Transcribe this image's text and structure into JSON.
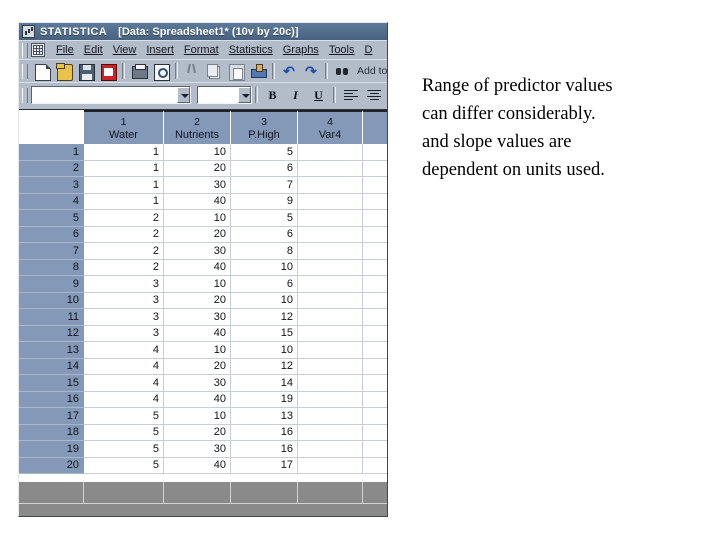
{
  "window": {
    "title_app": "STATISTICA",
    "title_document": "[Data: Spreadsheet1* (10v by 20c)]",
    "title_icon": "statistica-logo-icon"
  },
  "menu": {
    "doc_icon": "spreadsheet-icon",
    "items": [
      {
        "label": "File"
      },
      {
        "label": "Edit"
      },
      {
        "label": "View"
      },
      {
        "label": "Insert"
      },
      {
        "label": "Format"
      },
      {
        "label": "Statistics"
      },
      {
        "label": "Graphs"
      },
      {
        "label": "Tools"
      },
      {
        "label": "D"
      }
    ]
  },
  "toolbar_standard": {
    "buttons": [
      {
        "name": "new-document-icon"
      },
      {
        "name": "open-folder-icon"
      },
      {
        "name": "save-disk-icon"
      },
      {
        "name": "export-pdf-icon"
      },
      {
        "name": "print-icon"
      },
      {
        "name": "print-preview-icon"
      },
      {
        "name": "cut-scissors-icon"
      },
      {
        "name": "copy-icon"
      },
      {
        "name": "paste-icon"
      },
      {
        "name": "format-painter-icon"
      },
      {
        "name": "undo-icon"
      },
      {
        "name": "redo-icon"
      },
      {
        "name": "find-binoculars-icon"
      }
    ],
    "add_to_workbook_label": "Add to Workboo",
    "undo_glyph": "↶",
    "redo_glyph": "↷"
  },
  "toolbar_format": {
    "font_value": "",
    "font_placeholder": "",
    "size_value": "",
    "bold_label": "B",
    "italic_label": "I",
    "underline_label": "U",
    "align_left": "align-left-icon",
    "align_center": "align-center-icon",
    "align_right": "align-right-icon",
    "misc": "cell-properties-icon"
  },
  "spreadsheet": {
    "columns": [
      {
        "index": "1",
        "name": "Water"
      },
      {
        "index": "2",
        "name": "Nutrients"
      },
      {
        "index": "3",
        "name": "P.High"
      },
      {
        "index": "4",
        "name": "Var4"
      },
      {
        "index": "",
        "name": ""
      }
    ],
    "rows": [
      {
        "n": "1",
        "c": [
          "1",
          "10",
          "5",
          "",
          ""
        ]
      },
      {
        "n": "2",
        "c": [
          "1",
          "20",
          "6",
          "",
          ""
        ]
      },
      {
        "n": "3",
        "c": [
          "1",
          "30",
          "7",
          "",
          ""
        ]
      },
      {
        "n": "4",
        "c": [
          "1",
          "40",
          "9",
          "",
          ""
        ]
      },
      {
        "n": "5",
        "c": [
          "2",
          "10",
          "5",
          "",
          ""
        ]
      },
      {
        "n": "6",
        "c": [
          "2",
          "20",
          "6",
          "",
          ""
        ]
      },
      {
        "n": "7",
        "c": [
          "2",
          "30",
          "8",
          "",
          ""
        ]
      },
      {
        "n": "8",
        "c": [
          "2",
          "40",
          "10",
          "",
          ""
        ]
      },
      {
        "n": "9",
        "c": [
          "3",
          "10",
          "6",
          "",
          ""
        ]
      },
      {
        "n": "10",
        "c": [
          "3",
          "20",
          "10",
          "",
          ""
        ]
      },
      {
        "n": "11",
        "c": [
          "3",
          "30",
          "12",
          "",
          ""
        ]
      },
      {
        "n": "12",
        "c": [
          "3",
          "40",
          "15",
          "",
          ""
        ]
      },
      {
        "n": "13",
        "c": [
          "4",
          "10",
          "10",
          "",
          ""
        ]
      },
      {
        "n": "14",
        "c": [
          "4",
          "20",
          "12",
          "",
          ""
        ]
      },
      {
        "n": "15",
        "c": [
          "4",
          "30",
          "14",
          "",
          ""
        ]
      },
      {
        "n": "16",
        "c": [
          "4",
          "40",
          "19",
          "",
          ""
        ]
      },
      {
        "n": "17",
        "c": [
          "5",
          "10",
          "13",
          "",
          ""
        ]
      },
      {
        "n": "18",
        "c": [
          "5",
          "20",
          "16",
          "",
          ""
        ]
      },
      {
        "n": "19",
        "c": [
          "5",
          "30",
          "16",
          "",
          ""
        ]
      },
      {
        "n": "20",
        "c": [
          "5",
          "40",
          "17",
          "",
          ""
        ]
      }
    ]
  },
  "caption": {
    "lines": [
      "Range of predictor values",
      "can differ considerably.",
      "and slope values are",
      "dependent on units used."
    ]
  },
  "colors": {
    "title_bar": "#516d8b",
    "chrome": "#b3bcc9",
    "header_blue": "#8498b7",
    "grid_line": "#c9ced6",
    "footer_gray": "#8a8a8a",
    "text": "#10151c"
  }
}
